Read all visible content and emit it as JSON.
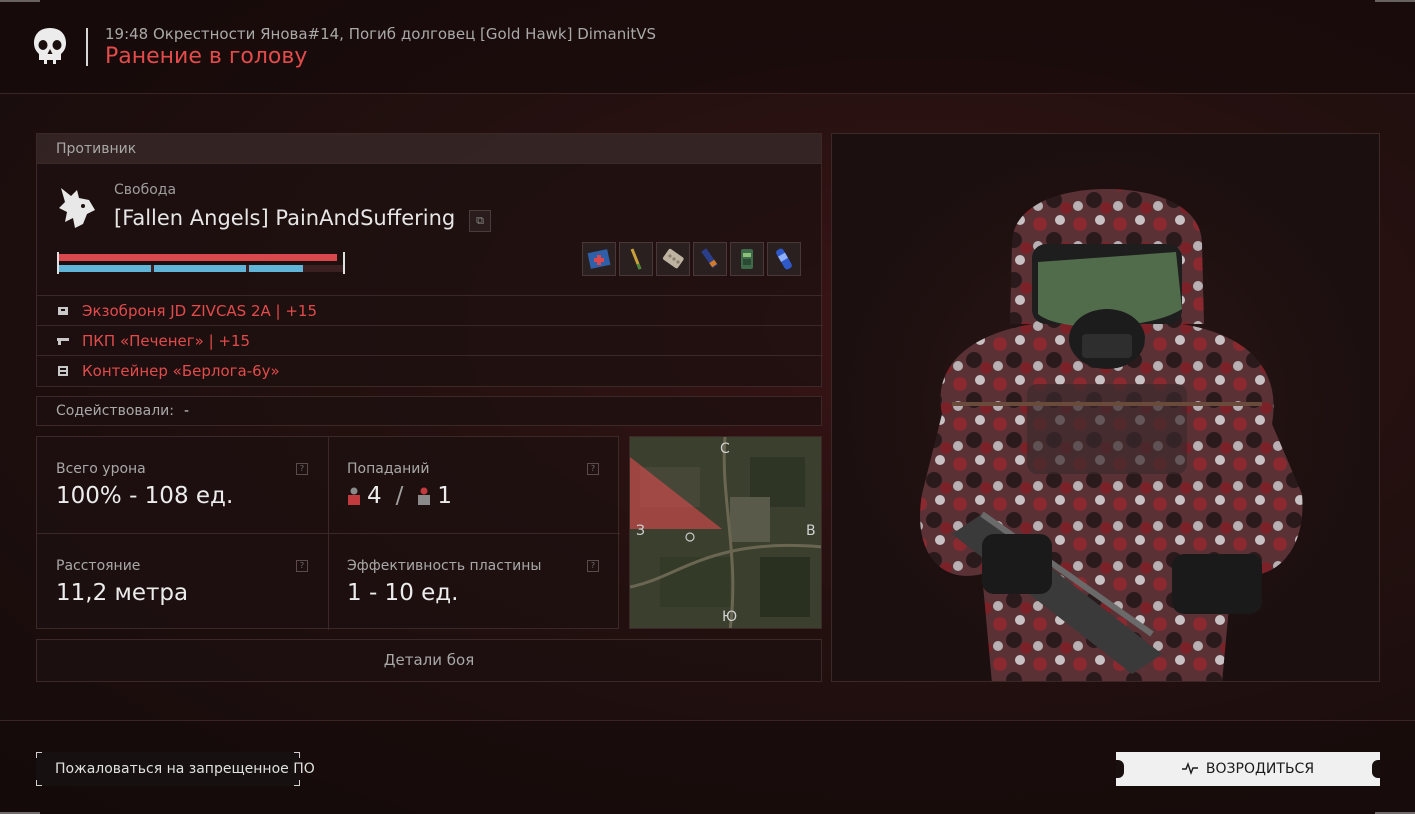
{
  "header": {
    "subtitle": "19:48 Окрестности Янова#14, Погиб долговец [Gold Hawk] DimanitVS",
    "title": "Ранение в голову"
  },
  "opponent": {
    "section_label": "Противник",
    "faction": "Свобода",
    "name": "[Fallen Angels] PainAndSuffering",
    "health_fraction": 1.0,
    "armor_fraction": 0.86,
    "items": [
      "medkit-icon",
      "injector-icon",
      "pills-icon",
      "syringe-icon",
      "battery-icon",
      "stimulant-icon"
    ],
    "loot": [
      {
        "icon": "armor-icon",
        "text": "Экзоброня JD ZIVCAS 2A  | +15"
      },
      {
        "icon": "rifle-icon",
        "text": "ПКП «Печенег»  | +15"
      },
      {
        "icon": "container-icon",
        "text": "Контейнер «Берлога-6у»"
      }
    ]
  },
  "assist": {
    "label": "Содействовали:",
    "value": "-"
  },
  "stats": {
    "total_damage_label": "Всего урона",
    "total_damage_value": "100% - 108 ед.",
    "hits_label": "Попаданий",
    "hits_a": "4",
    "hits_sep": "/",
    "hits_b": "1",
    "distance_label": "Расстояние",
    "distance_value": "11,2 метра",
    "plate_label": "Эффективность пластины",
    "plate_value": "1 - 10 ед.",
    "help": "?"
  },
  "map": {
    "north": "С",
    "west": "З",
    "east": "В",
    "south": "Ю"
  },
  "buttons": {
    "details": "Детали боя",
    "report": "Пожаловаться на запрещенное ПО",
    "respawn": "ВОЗРОДИТЬСЯ"
  },
  "colors": {
    "accent_red": "#e24b4b",
    "armor_blue": "#5fb4d8"
  }
}
